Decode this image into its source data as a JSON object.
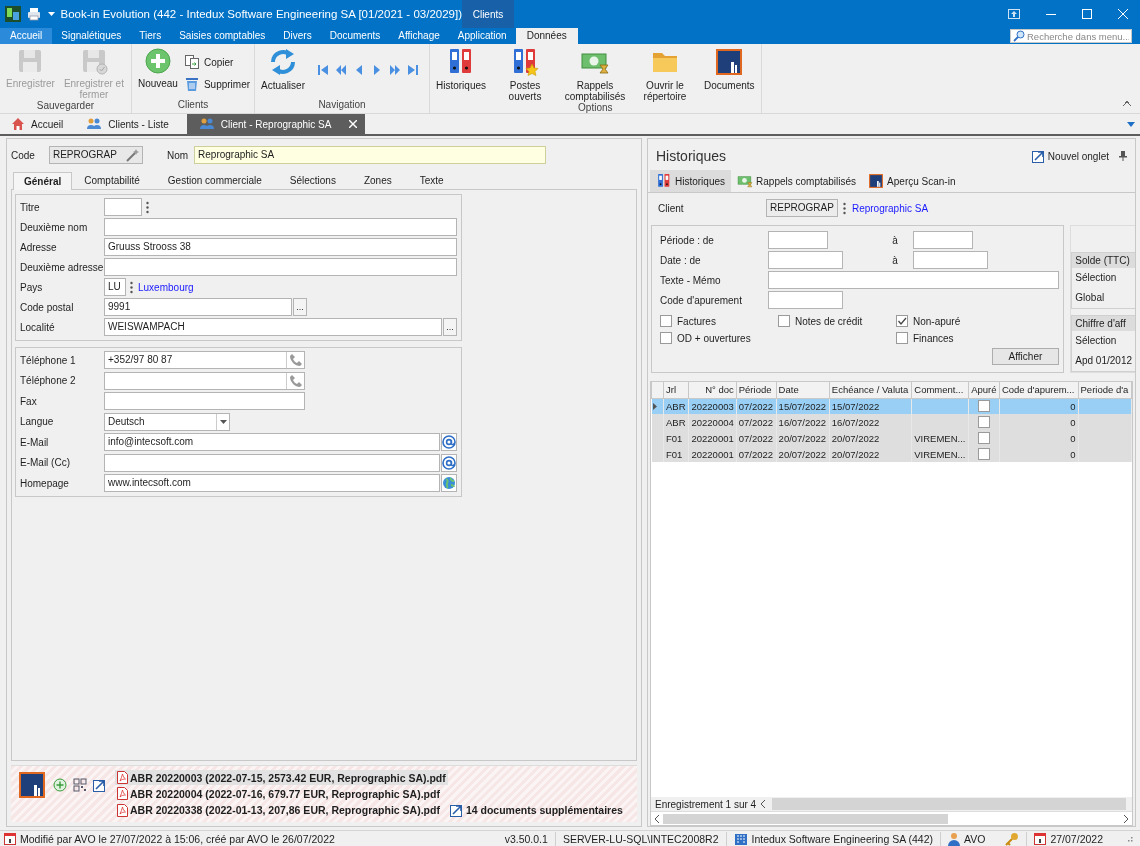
{
  "window": {
    "title": "Book-in Evolution (442 - Intedux Software Engineering SA [01/2021 - 03/2029])",
    "context_tab": "Clients"
  },
  "menu": {
    "tabs": [
      {
        "label": "Accueil",
        "kind": "file",
        "selected": false
      },
      {
        "label": "Signalétiques",
        "kind": "tab",
        "selected": false
      },
      {
        "label": "Tiers",
        "kind": "tab",
        "selected": false
      },
      {
        "label": "Saisies comptables",
        "kind": "tab",
        "selected": false
      },
      {
        "label": "Divers",
        "kind": "tab",
        "selected": false
      },
      {
        "label": "Documents",
        "kind": "tab",
        "selected": false
      },
      {
        "label": "Affichage",
        "kind": "tab",
        "selected": false
      },
      {
        "label": "Application",
        "kind": "tab",
        "selected": false
      },
      {
        "label": "Données",
        "kind": "tab",
        "selected": true
      }
    ],
    "search": {
      "placeholder": "Recherche dans menu..."
    }
  },
  "ribbon": {
    "groups": [
      {
        "label": "Sauvegarder",
        "items": [
          {
            "kind": "large",
            "label": "Enregistrer",
            "disabled": true
          },
          {
            "kind": "large",
            "label": "Enregistrer et fermer",
            "disabled": true
          }
        ]
      },
      {
        "label": "Clients",
        "items": [
          {
            "kind": "large",
            "label": "Nouveau",
            "disabled": false
          },
          {
            "kind": "small",
            "label": "Copier",
            "disabled": false
          },
          {
            "kind": "small",
            "label": "Supprimer",
            "disabled": false
          }
        ]
      },
      {
        "label": "Navigation",
        "items": [
          {
            "kind": "large",
            "label": "Actualiser",
            "disabled": false
          },
          {
            "kind": "nav"
          },
          {
            "kind": "nav"
          },
          {
            "kind": "nav"
          },
          {
            "kind": "nav"
          },
          {
            "kind": "nav"
          },
          {
            "kind": "nav"
          }
        ]
      },
      {
        "label": "Options",
        "items": [
          {
            "kind": "large",
            "label": "Historiques",
            "disabled": false
          },
          {
            "kind": "large",
            "label": "Postes ouverts",
            "disabled": false
          },
          {
            "kind": "large",
            "label": "Rappels comptabilisés",
            "disabled": false
          },
          {
            "kind": "large",
            "label": "Ouvrir le répertoire",
            "disabled": false
          },
          {
            "kind": "large",
            "label": "Documents",
            "disabled": false
          }
        ]
      }
    ]
  },
  "doc_tabs": [
    {
      "label": "Accueil",
      "selected": false
    },
    {
      "label": "Clients - Liste",
      "selected": false
    },
    {
      "label": "Client - Reprographic SA",
      "selected": true
    }
  ],
  "client": {
    "code": {
      "label": "Code",
      "value": "REPROGRAP"
    },
    "name": {
      "label": "Nom",
      "value": "Reprographic SA"
    },
    "tabs": [
      {
        "label": "Général",
        "selected": true
      },
      {
        "label": "Comptabilité",
        "selected": false
      },
      {
        "label": "Gestion commerciale",
        "selected": false
      },
      {
        "label": "Sélections",
        "selected": false
      },
      {
        "label": "Zones",
        "selected": false
      },
      {
        "label": "Texte",
        "selected": false
      }
    ],
    "address": [
      {
        "kind": "picker",
        "label": "Titre"
      },
      {
        "kind": "text",
        "label": "Deuxième nom"
      },
      {
        "kind": "text",
        "label": "Adresse",
        "value": "Gruuss Strooss 38"
      },
      {
        "kind": "text",
        "label": "Deuxième adresse"
      },
      {
        "kind": "country",
        "label": "Pays",
        "value": "LU",
        "link": "Luxembourg"
      },
      {
        "kind": "postal",
        "label": "Code postal",
        "value": "9991",
        "button": "..."
      },
      {
        "kind": "locality",
        "label": "Localité",
        "value": "WEISWAMPACH",
        "button": "..."
      }
    ],
    "contact": [
      {
        "kind": "phone",
        "label": "Téléphone 1",
        "value": "+352/97 80 87"
      },
      {
        "kind": "phone",
        "label": "Téléphone 2"
      },
      {
        "kind": "medium",
        "label": "Fax"
      },
      {
        "kind": "dropdown",
        "label": "Langue",
        "value": "Deutsch"
      },
      {
        "kind": "email",
        "label": "E-Mail",
        "value": "info@intecsoft.com"
      },
      {
        "kind": "email",
        "label": "E-Mail (Cc)"
      },
      {
        "kind": "web",
        "label": "Homepage",
        "value": "www.intecsoft.com"
      }
    ]
  },
  "documents": {
    "files": [
      {
        "label": "ABR 20220003 (2022-07-15, 2573.42 EUR, Reprographic SA).pdf",
        "selected": true
      },
      {
        "label": "ABR 20220004 (2022-07-16, 679.77 EUR, Reprographic SA).pdf",
        "selected": false
      },
      {
        "label": "ABR 20220338 (2022-01-13, 207,86 EUR, Reprographic SA).pdf",
        "selected": false
      }
    ],
    "more": "14 documents supplémentaires"
  },
  "history": {
    "title": "Historiques",
    "new_tab": "Nouvel onglet",
    "tabs": [
      {
        "label": "Historiques",
        "selected": true
      },
      {
        "label": "Rappels comptabilisés",
        "selected": false
      },
      {
        "label": "Aperçu Scan-in",
        "selected": false
      }
    ],
    "client": {
      "label": "Client",
      "code": "REPROGRAP",
      "name": "Reprographic SA"
    },
    "filters": [
      {
        "kind": "range-short",
        "label": "Période : de",
        "to_label": "à"
      },
      {
        "kind": "range",
        "label": "Date : de",
        "to_label": "à"
      },
      {
        "kind": "wide",
        "label": "Texte - Mémo"
      },
      {
        "kind": "single",
        "label": "Code d'apurement"
      }
    ],
    "checkboxes": [
      {
        "label": "Factures",
        "checked": false
      },
      {
        "label": "Notes de crédit",
        "checked": false
      },
      {
        "label": "Non-apuré",
        "checked": true
      },
      {
        "label": "OD + ouvertures",
        "checked": false
      },
      {
        "label": "Finances",
        "checked": false
      }
    ],
    "show_button": "Afficher",
    "summary": [
      {
        "header": "Solde (TTC)",
        "lines": [
          "Sélection",
          "Global"
        ]
      },
      {
        "header": "Chiffre d'aff",
        "lines": [
          "Sélection",
          "Apd 01/2012"
        ]
      }
    ],
    "grid": {
      "columns": [
        "Jrl",
        "N° doc",
        "Période",
        "Date",
        "Echéance / Valuta",
        "Comment...",
        "Apuré",
        "Code d'apurem...",
        "Periode d'a"
      ],
      "rows": [
        {
          "selected": true,
          "jrl": "ABR",
          "doc": "20220003",
          "period": "07/2022",
          "date": "15/07/2022",
          "due": "15/07/2022",
          "settled": false,
          "code": "0"
        },
        {
          "selected": false,
          "jrl": "ABR",
          "doc": "20220004",
          "period": "07/2022",
          "date": "16/07/2022",
          "due": "16/07/2022",
          "settled": false,
          "code": "0"
        },
        {
          "selected": false,
          "jrl": "F01",
          "doc": "20220001",
          "period": "07/2022",
          "date": "20/07/2022",
          "due": "20/07/2022",
          "comment": "VIREMEN...",
          "settled": false,
          "code": "0"
        },
        {
          "selected": false,
          "jrl": "F01",
          "doc": "20220001",
          "period": "07/2022",
          "date": "20/07/2022",
          "due": "20/07/2022",
          "comment": "VIREMEN...",
          "settled": false,
          "code": "0"
        }
      ],
      "footer": "Enregistrement 1 sur 4"
    }
  },
  "status_bar": {
    "modified": "Modifié par AVO le 27/07/2022 à 15:06, créé par AVO le 26/07/2022",
    "version": "v3.50.0.1",
    "server": "SERVER-LU-SQL\\INTEC2008R2",
    "company": "Intedux Software Engineering SA (442)",
    "user": "AVO",
    "date": "27/07/2022"
  }
}
